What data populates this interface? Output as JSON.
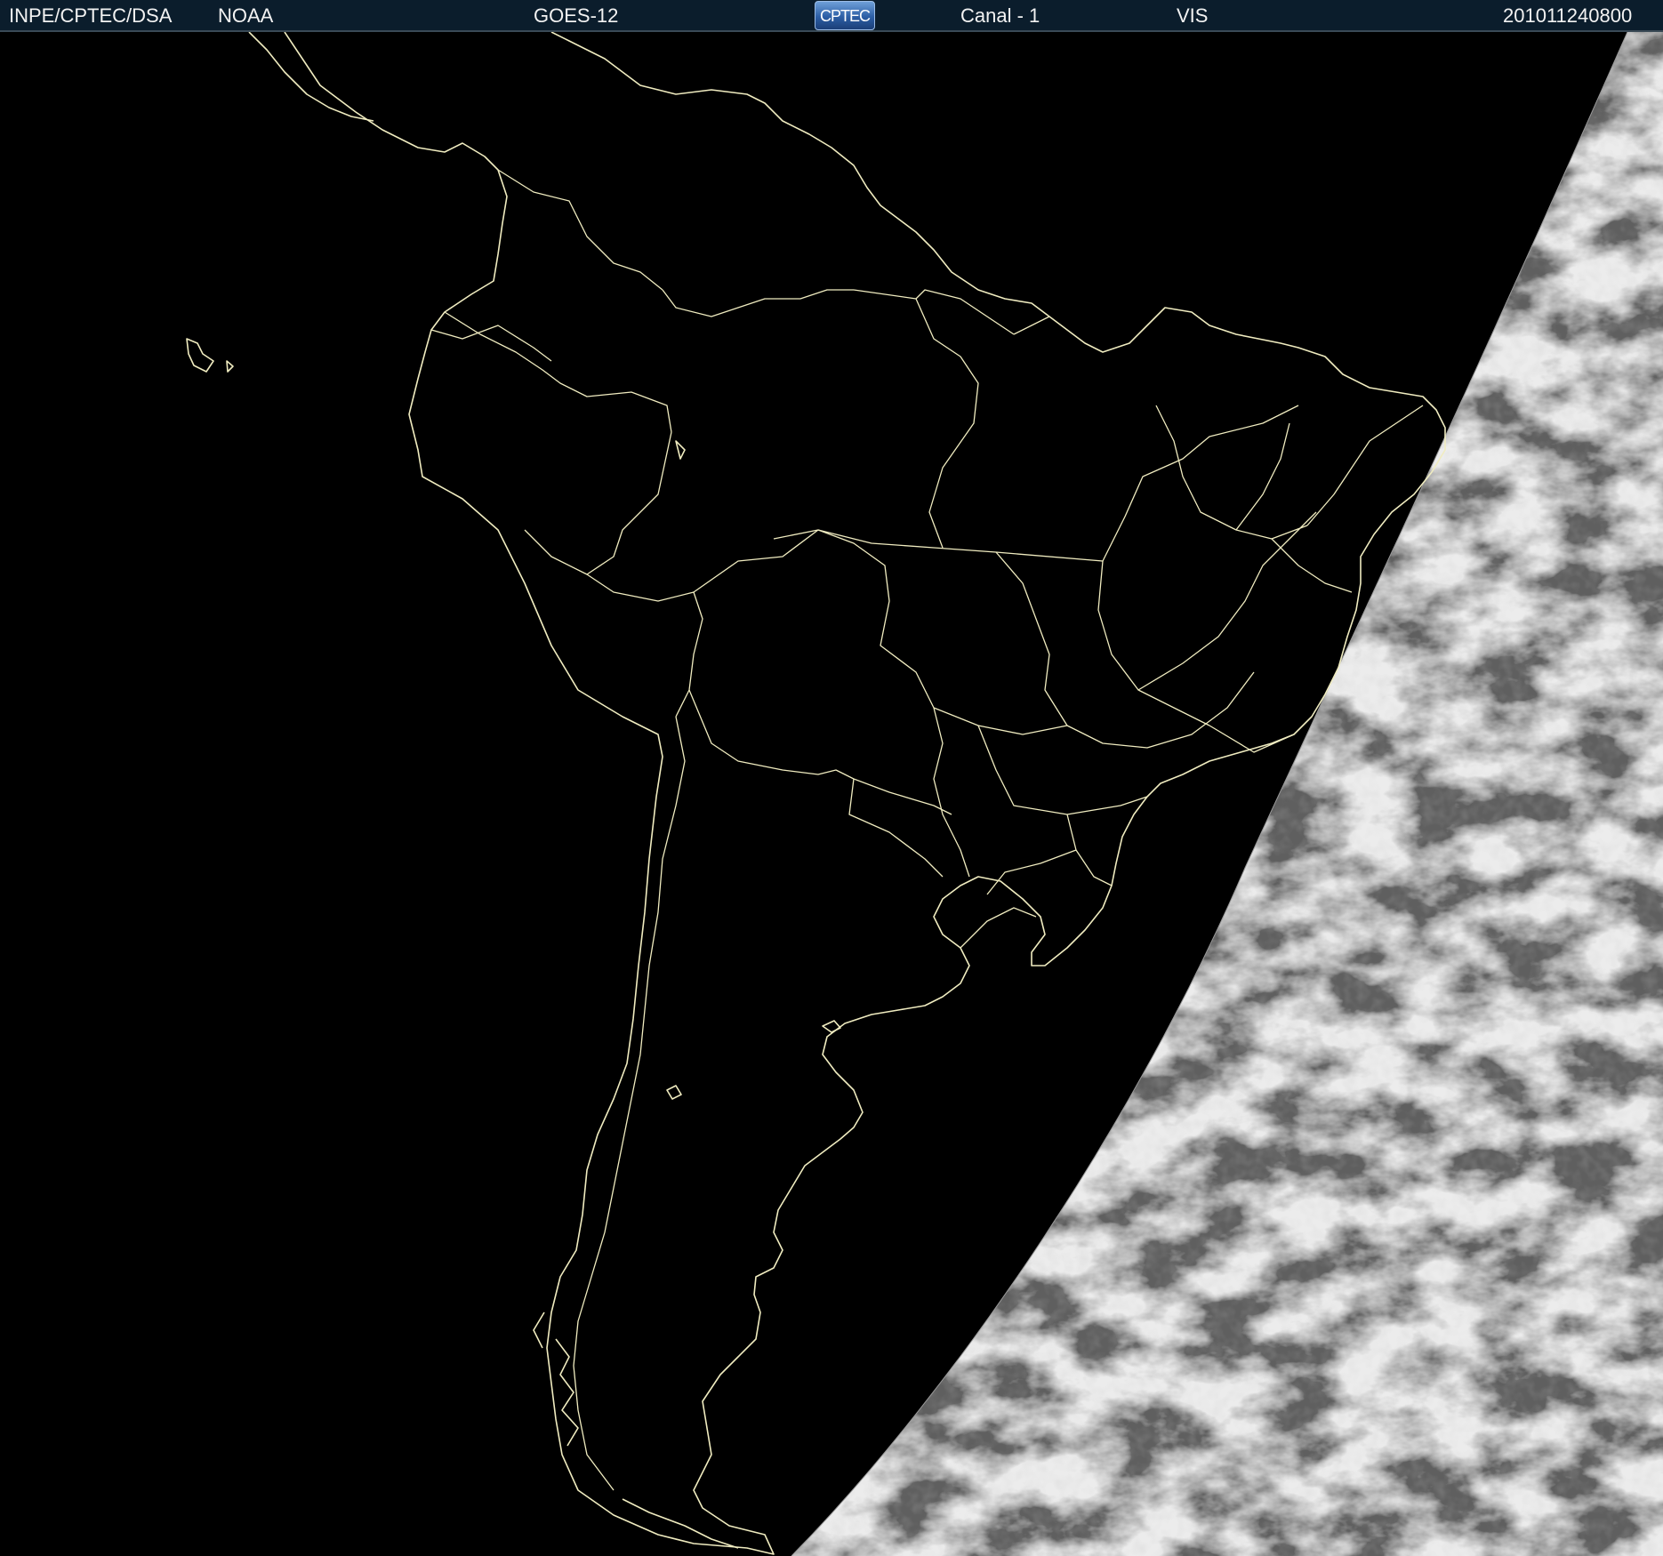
{
  "header": {
    "organization": "INPE/CPTEC/DSA",
    "agency": "NOAA",
    "satellite": "GOES-12",
    "logo_text": "CPTEC",
    "channel": "Canal - 1",
    "band": "VIS",
    "timestamp": "201011240800"
  },
  "map": {
    "region": "South America",
    "background_color": "#000000",
    "boundary_color": "#f0ecc0",
    "cloud_gray_light": "#f2f2f2",
    "cloud_gray_dark": "#6a6a6a"
  }
}
